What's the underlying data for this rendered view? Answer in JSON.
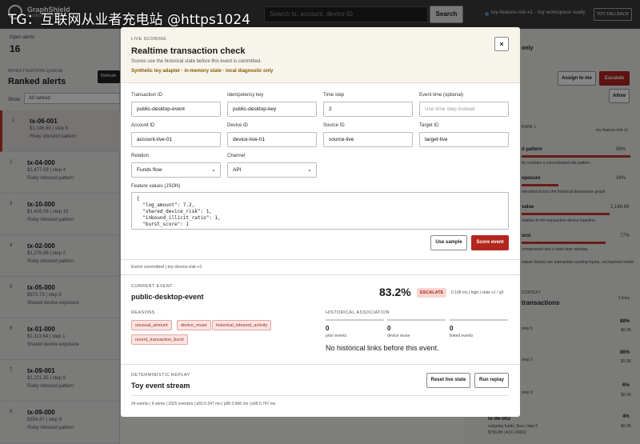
{
  "watermark": "TG：互联网从业者充电站 @https1024",
  "topbar": {
    "brand": "GraphShield",
    "brand_sub": "Analyst workspace",
    "search_placeholder": "Search tx, account, device ID",
    "search_label": "Search",
    "status": "toy-feature-risk-v1 · toy workspace ready",
    "fallback": "TOY FALLBACK"
  },
  "left": {
    "open_label": "Open alerts",
    "open_count": "16",
    "kicker": "INVESTIGATION QUEUE",
    "title": "Ranked alerts",
    "refresh": "Refresh",
    "show_label": "Show",
    "show_value": "All ranked",
    "alerts": [
      {
        "idx": "1",
        "id": "tx-06-001",
        "meta": "$1,146.69 | step 6",
        "pattern": "Risky inbound pattern"
      },
      {
        "idx": "2",
        "id": "tx-04-000",
        "meta": "$1,477.59 | step 4",
        "pattern": "Risky inbound pattern"
      },
      {
        "idx": "3",
        "id": "tx-10-000",
        "meta": "$1,426.06 | step 10",
        "pattern": "Risky inbound pattern"
      },
      {
        "idx": "4",
        "id": "tx-02-000",
        "meta": "$1,276.96 | step 2",
        "pattern": "Risky inbound pattern"
      },
      {
        "idx": "5",
        "id": "tx-05-000",
        "meta": "$972.73 | step 5",
        "pattern": "Shared device exposure"
      },
      {
        "idx": "6",
        "id": "tx-01-000",
        "meta": "$1,113.64 | step 1",
        "pattern": "Shared device exposure"
      },
      {
        "idx": "7",
        "id": "tx-09-001",
        "meta": "$1,221.35 | step 9",
        "pattern": "Risky inbound pattern"
      },
      {
        "idx": "8",
        "id": "tx-09-000",
        "meta": "$354.47 | step 9",
        "pattern": "Risky inbound pattern"
      }
    ]
  },
  "right": {
    "only": "only",
    "assign": "Assign to me",
    "escalate": "Escalate",
    "allow": "Allow",
    "rank_kicker": "RANK 1",
    "model": "toy-feature-risk-v1",
    "pattern": "d pattern",
    "pattern_pct": "99%",
    "pattern_note": "ify contains a concentrated risk pattern.",
    "exposure": "xposure",
    "exposure_pct": "34%",
    "exposure_note": "elevated across the historical transaction graph.",
    "value": "value",
    "value_amt": "1,146.69",
    "value_note": "relative to the transaction device baseline.",
    "burst": "urst",
    "burst_pct": "77%",
    "burst_note": "compressed into a short time window.",
    "footnote": "eature factors are transaction scoring inputs, not learned model",
    "context_kicker": "CONTEXT",
    "context_title": "transactions",
    "context_count": "5 links",
    "list": [
      {
        "pct": "88%",
        "sub": "step 5",
        "sub2": "$0.0K"
      },
      {
        "pct": "86%",
        "sub": "step 5",
        "sub2": "$0.0K"
      },
      {
        "pct": "6%",
        "sub": "step 9",
        "sub2": "$0.0K"
      },
      {
        "pct": "4%",
        "id": "tx-06-002",
        "sub": "outgoing funds_flow | step 6",
        "sub2": "$756.88 | ACC-00002"
      }
    ]
  },
  "modal": {
    "kicker": "LIVE SCORING",
    "title": "Realtime transaction check",
    "subtitle": "Scores use the historical state before this event is committed.",
    "note": "Synthetic toy adapter · in-memory state · local diagnostic only",
    "close": "×",
    "fields": {
      "transaction_id": {
        "label": "Transaction ID",
        "value": "public-desktop-event"
      },
      "idempotency_key": {
        "label": "Idempotency key",
        "value": "public-desktop-key"
      },
      "time_step": {
        "label": "Time step",
        "value": "2"
      },
      "event_time": {
        "label": "Event time (optional)",
        "placeholder": "Use time step instead"
      },
      "account_id": {
        "label": "Account ID",
        "value": "account-live-01"
      },
      "device_id": {
        "label": "Device ID",
        "value": "device-live-01"
      },
      "source_id": {
        "label": "Source ID",
        "value": "source-live"
      },
      "target_id": {
        "label": "Target ID",
        "value": "target-live"
      },
      "relation": {
        "label": "Relation",
        "value": "Funds flow"
      },
      "channel": {
        "label": "Channel",
        "value": "API"
      },
      "features_label": "Feature values (JSON)",
      "features_json": "{\n  \"log_amount\": 7.2,\n  \"shared_device_risk\": 1,\n  \"inbound_illicit_ratio\": 1,\n  \"burst_score\": 1"
    },
    "use_sample": "Use sample",
    "score_event": "Score event",
    "event_committed": "Event committed | toy-device-risk-v1",
    "current_kicker": "CURRENT EVENT",
    "current_title": "public-desktop-event",
    "score_pct": "83.2%",
    "decision": "ESCALATE",
    "score_meta": "0.168 ms | high | state v1 / g0",
    "reasons_kicker": "REASONS",
    "reasons": [
      "unusual_amount",
      "device_reuse",
      "historical_inbound_activity",
      "recent_transaction_burst"
    ],
    "hist_kicker": "HISTORICAL ASSOCIATION",
    "hist": [
      {
        "num": "0",
        "label": "prior events"
      },
      {
        "num": "0",
        "label": "device reuse"
      },
      {
        "num": "0",
        "label": "linked events"
      }
    ],
    "no_hist": "No historical links before this event.",
    "replay_kicker": "DETERMINISTIC REPLAY",
    "replay_title": "Toy event stream",
    "reset": "Reset live state",
    "run_replay": "Run replay",
    "stream_stats": "24 events | 6 alerts | 2025 events/s | p50 0.347 ms | p95 0.666 ms | p99 0.747 ms"
  }
}
